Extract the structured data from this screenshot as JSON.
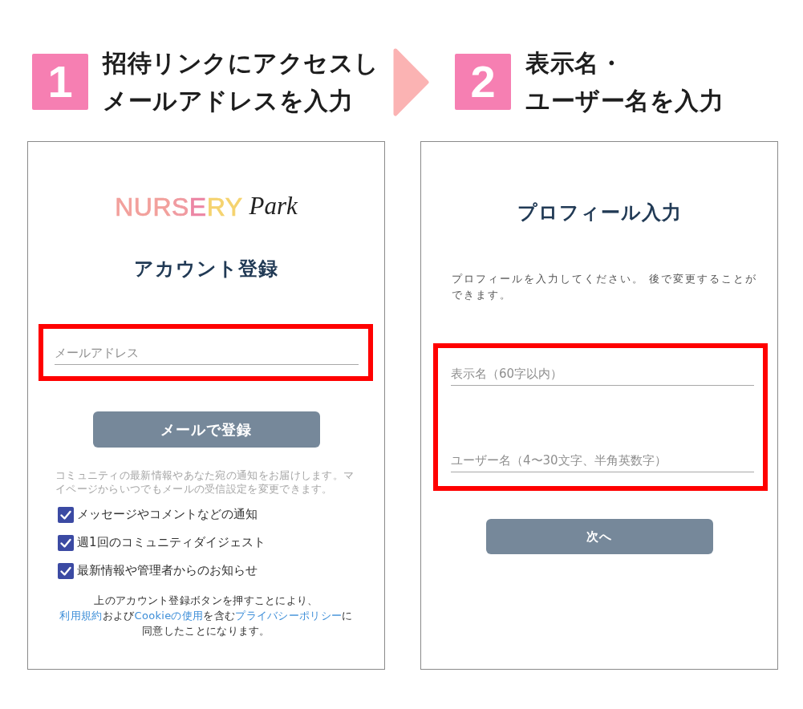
{
  "steps": [
    {
      "number": "1",
      "lines": [
        "招待リンクにアクセスし",
        "メールアドレスを入力"
      ]
    },
    {
      "number": "2",
      "lines": [
        "表示名・",
        "ユーザー名を入力"
      ]
    }
  ],
  "signup_screen": {
    "logo": {
      "wordmark": "NURSERY",
      "script": "Park"
    },
    "title": "アカウント登録",
    "highlighted": true,
    "email_field": {
      "placeholder": "メールアドレス"
    },
    "submit_button": "メールで登録",
    "notice": "コミュニティの最新情報やあなた宛の通知をお届けします。マイページからいつでもメールの受信設定を変更できます。",
    "options": [
      {
        "label": "メッセージやコメントなどの通知",
        "checked": true
      },
      {
        "label": "週1回のコミュニティダイジェスト",
        "checked": true
      },
      {
        "label": "最新情報や管理者からのお知らせ",
        "checked": true
      }
    ],
    "consent_lines": [
      [
        {
          "kind": "text",
          "text": "上のアカウント登録ボタンを押すことにより、"
        }
      ],
      [
        {
          "kind": "link",
          "text": "利用規約"
        },
        {
          "kind": "text",
          "text": "および"
        },
        {
          "kind": "link",
          "text": "Cookieの使用"
        },
        {
          "kind": "text",
          "text": "を含む"
        },
        {
          "kind": "link",
          "text": "プライバシーポリシー"
        },
        {
          "kind": "text",
          "text": "に"
        }
      ],
      [
        {
          "kind": "text",
          "text": "同意したことになります。"
        }
      ]
    ]
  },
  "profile_screen": {
    "title": "プロフィール入力",
    "description": "プロフィールを入力してください。 後で変更することができます。",
    "highlighted": true,
    "fields": [
      {
        "placeholder": "表示名（60字以内）"
      },
      {
        "placeholder": "ユーザー名（4〜30文字、半角英数字）"
      }
    ],
    "next_button": "次へ"
  }
}
